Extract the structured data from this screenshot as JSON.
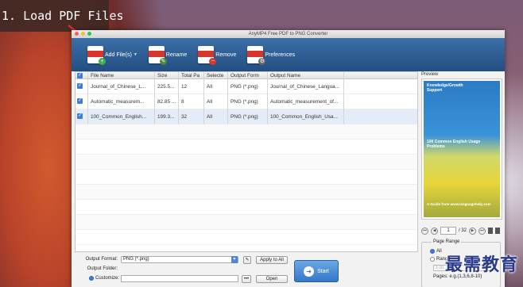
{
  "overlay": {
    "step_label": "1. Load PDF Files"
  },
  "window": {
    "title": "AnyMP4 Free PDF to PNG Converter"
  },
  "toolbar": {
    "add_label": "Add File(s)",
    "rename_label": "Rename",
    "remove_label": "Remove",
    "prefs_label": "Preferences"
  },
  "table": {
    "headers": [
      "File Name",
      "Size",
      "Total Pa",
      "Selecte",
      "Output Form",
      "Output Name"
    ],
    "rows": [
      {
        "file": "Journal_of_Chinese_L...",
        "size": "225.5...",
        "total": "12",
        "selected": "All",
        "format": "PNG (*.png)",
        "output": "Journal_of_Chinese_Langua..."
      },
      {
        "file": "Automatic_measurem...",
        "size": "82.85 ...",
        "total": "8",
        "selected": "All",
        "format": "PNG (*.png)",
        "output": "Automatic_measurement_of..."
      },
      {
        "file": "100_Common_English...",
        "size": "199.3...",
        "total": "32",
        "selected": "All",
        "format": "PNG (*.png)",
        "output": "100_Common_English_Usa..."
      }
    ]
  },
  "preview": {
    "label": "Preview",
    "cover_title": "Knowledge/Growth Support",
    "cover_subtitle": "100 Common English Usage Problems",
    "cover_footer": "A Guide from www.languagehelp.com",
    "page_value": "1",
    "page_total": "/ 32"
  },
  "page_range": {
    "title": "Page Range",
    "opt_all": "All",
    "opt_range": "Range",
    "range_placeholder": "1-10",
    "hint": "Pages: e.g.(1,3,6,8-10)"
  },
  "output": {
    "format_label": "Output Format:",
    "format_value": "PNG (*.png)",
    "apply_all": "Apply to All",
    "folder_label": "Output Folder:",
    "customize_label": "Customize:",
    "folder_dots": "•••",
    "open_label": "Open",
    "start_label": "Start"
  },
  "watermark": {
    "text": "最需教育"
  },
  "colors": {
    "toolbar": "#2f5f95",
    "accent": "#3d7de0"
  }
}
